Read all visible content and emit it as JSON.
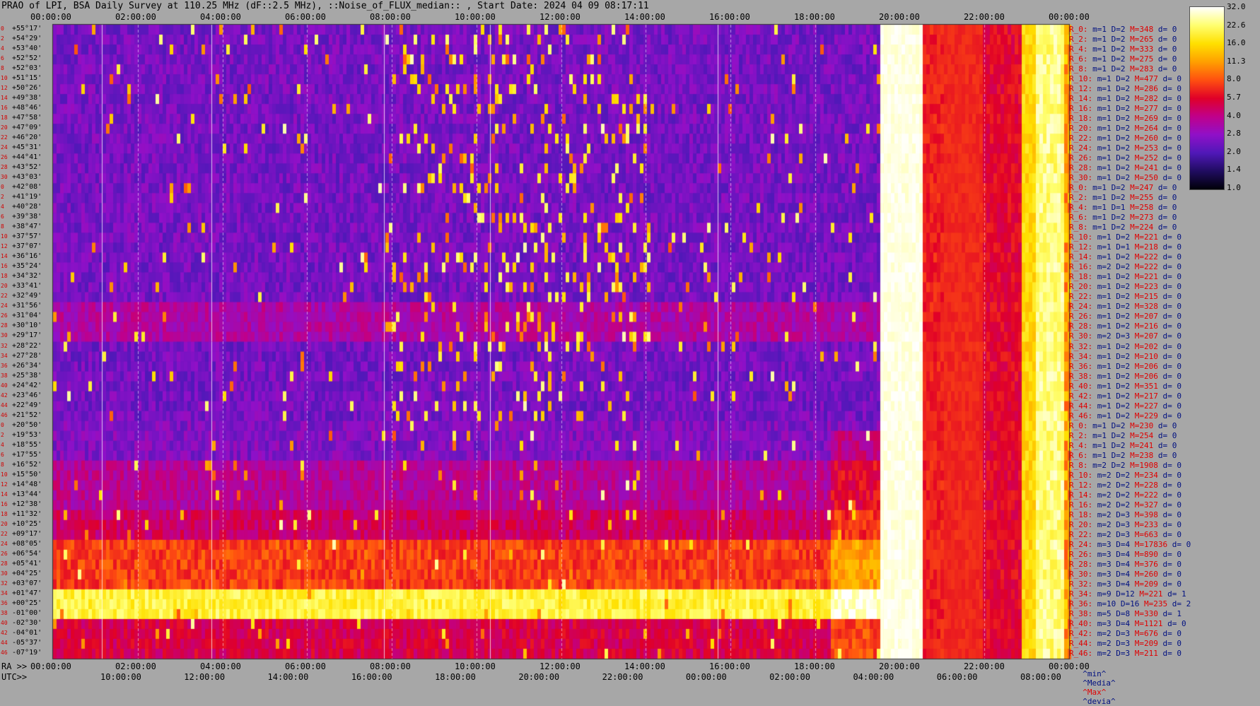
{
  "title": "PRAO of LPI, BSA Daily Survey at 110.25 MHz (dF::2.5 MHz), ::Noise_of_FLUX_median:: , Start Date: 2024 04 09 08:17:11",
  "chart_data": {
    "type": "heatmap",
    "title": "PRAO of LPI, BSA Daily Survey at 110.25 MHz (dF::2.5 MHz), ::Noise_of_FLUX_median:: , Start Date: 2024 04 09 08:17:11",
    "x_top_ticks": [
      "00:00:00",
      "02:00:00",
      "04:00:00",
      "06:00:00",
      "08:00:00",
      "10:00:00",
      "12:00:00",
      "14:00:00",
      "16:00:00",
      "18:00:00",
      "20:00:00",
      "22:00:00",
      "00:00:00"
    ],
    "x_ra_ticks": [
      "00:00:00",
      "02:00:00",
      "04:00:00",
      "06:00:00",
      "08:00:00",
      "10:00:00",
      "12:00:00",
      "14:00:00",
      "16:00:00",
      "18:00:00",
      "20:00:00",
      "22:00:00",
      "00:00:00"
    ],
    "x_utc_ticks": [
      "10:00:00",
      "12:00:00",
      "14:00:00",
      "16:00:00",
      "18:00:00",
      "20:00:00",
      "22:00:00",
      "00:00:00",
      "02:00:00",
      "04:00:00",
      "06:00:00",
      "08:00:00"
    ],
    "xlabel_ra": "RA >>",
    "xlabel_utc": "UTC>>",
    "declinations": [
      "+55°17'",
      "+54°29'",
      "+53°40'",
      "+52°52'",
      "+52°03'",
      "+51°15'",
      "+50°26'",
      "+49°38'",
      "+48°46'",
      "+47°58'",
      "+47°09'",
      "+46°20'",
      "+45°31'",
      "+44°41'",
      "+43°52'",
      "+43°03'",
      "+42°08'",
      "+41°19'",
      "+40°28'",
      "+39°38'",
      "+38°47'",
      "+37°57'",
      "+37°07'",
      "+36°16'",
      "+35°24'",
      "+34°32'",
      "+33°41'",
      "+32°49'",
      "+31°56'",
      "+31°04'",
      "+30°10'",
      "+29°17'",
      "+28°22'",
      "+27°28'",
      "+26°34'",
      "+25°38'",
      "+24°42'",
      "+23°46'",
      "+22°49'",
      "+21°52'",
      "+20°50'",
      "+19°53'",
      "+18°55'",
      "+17°55'",
      "+16°52'",
      "+15°50'",
      "+14°48'",
      "+13°44'",
      "+12°38'",
      "+11°32'",
      "+10°25'",
      "+09°17'",
      "+08°05'",
      "+06°54'",
      "+05°41'",
      "+04°25'",
      "+03°07'",
      "+01°47'",
      "+00°25'",
      "-01°00'",
      "-02°30'",
      "-04°01'",
      "-05°37'",
      "-07°19'"
    ],
    "row_indices": [
      "0",
      "2",
      "4",
      "6",
      "8",
      "10",
      "12",
      "14",
      "16",
      "18",
      "20",
      "22",
      "24",
      "26",
      "28",
      "30",
      "0",
      "2",
      "4",
      "6",
      "8",
      "10",
      "12",
      "14",
      "16",
      "18",
      "20",
      "22",
      "24",
      "26",
      "28",
      "30",
      "32",
      "34",
      "36",
      "38",
      "40",
      "42",
      "44",
      "46",
      "0",
      "2",
      "4",
      "6",
      "8",
      "10",
      "12",
      "14",
      "16",
      "18",
      "20",
      "22",
      "24",
      "26",
      "28",
      "30",
      "32",
      "34",
      "36",
      "38",
      "40",
      "42",
      "44",
      "46"
    ],
    "colorbar": {
      "ticks": [
        "32.0",
        "22.6",
        "16.0",
        "11.3",
        "8.0",
        "5.7",
        "4.0",
        "2.8",
        "2.0",
        "1.4",
        "1.0"
      ],
      "colors": [
        "#ffffff",
        "#ffff70",
        "#ffe000",
        "#ffa000",
        "#ff5010",
        "#e00028",
        "#c0008a",
        "#9010c8",
        "#5018b8",
        "#200c60",
        "#000008"
      ]
    },
    "stats": [
      {
        "r": "R_0:",
        "m": "1",
        "D": "2",
        "M": "348",
        "d": "0"
      },
      {
        "r": "R_2:",
        "m": "1",
        "D": "2",
        "M": "265",
        "d": "0"
      },
      {
        "r": "R_4:",
        "m": "1",
        "D": "2",
        "M": "333",
        "d": "0"
      },
      {
        "r": "R_6:",
        "m": "1",
        "D": "2",
        "M": "275",
        "d": "0"
      },
      {
        "r": "R_8:",
        "m": "1",
        "D": "2",
        "M": "283",
        "d": "0"
      },
      {
        "r": "R_10:",
        "m": "1",
        "D": "2",
        "M": "477",
        "d": "0"
      },
      {
        "r": "R_12:",
        "m": "1",
        "D": "2",
        "M": "286",
        "d": "0"
      },
      {
        "r": "R_14:",
        "m": "1",
        "D": "2",
        "M": "282",
        "d": "0"
      },
      {
        "r": "R_16:",
        "m": "1",
        "D": "2",
        "M": "277",
        "d": "0"
      },
      {
        "r": "R_18:",
        "m": "1",
        "D": "2",
        "M": "269",
        "d": "0"
      },
      {
        "r": "R_20:",
        "m": "1",
        "D": "2",
        "M": "264",
        "d": "0"
      },
      {
        "r": "R_22:",
        "m": "1",
        "D": "2",
        "M": "260",
        "d": "0"
      },
      {
        "r": "R_24:",
        "m": "1",
        "D": "2",
        "M": "253",
        "d": "0"
      },
      {
        "r": "R_26:",
        "m": "1",
        "D": "2",
        "M": "252",
        "d": "0"
      },
      {
        "r": "R_28:",
        "m": "1",
        "D": "2",
        "M": "241",
        "d": "0"
      },
      {
        "r": "R_30:",
        "m": "1",
        "D": "2",
        "M": "250",
        "d": "0"
      },
      {
        "r": "R_0:",
        "m": "1",
        "D": "2",
        "M": "247",
        "d": "0"
      },
      {
        "r": "R_2:",
        "m": "1",
        "D": "2",
        "M": "255",
        "d": "0"
      },
      {
        "r": "R_4:",
        "m": "1",
        "D": "1",
        "M": "258",
        "d": "0"
      },
      {
        "r": "R_6:",
        "m": "1",
        "D": "2",
        "M": "273",
        "d": "0"
      },
      {
        "r": "R_8:",
        "m": "1",
        "D": "2",
        "M": "224",
        "d": "0"
      },
      {
        "r": "R_10:",
        "m": "1",
        "D": "2",
        "M": "221",
        "d": "0"
      },
      {
        "r": "R_12:",
        "m": "1",
        "D": "1",
        "M": "218",
        "d": "0"
      },
      {
        "r": "R_14:",
        "m": "1",
        "D": "2",
        "M": "222",
        "d": "0"
      },
      {
        "r": "R_16:",
        "m": "2",
        "D": "2",
        "M": "222",
        "d": "0"
      },
      {
        "r": "R_18:",
        "m": "1",
        "D": "2",
        "M": "221",
        "d": "0"
      },
      {
        "r": "R_20:",
        "m": "1",
        "D": "2",
        "M": "223",
        "d": "0"
      },
      {
        "r": "R_22:",
        "m": "1",
        "D": "2",
        "M": "215",
        "d": "0"
      },
      {
        "r": "R_24:",
        "m": "1",
        "D": "2",
        "M": "328",
        "d": "0"
      },
      {
        "r": "R_26:",
        "m": "1",
        "D": "2",
        "M": "207",
        "d": "0"
      },
      {
        "r": "R_28:",
        "m": "1",
        "D": "2",
        "M": "216",
        "d": "0"
      },
      {
        "r": "R_30:",
        "m": "2",
        "D": "3",
        "M": "207",
        "d": "0"
      },
      {
        "r": "R_32:",
        "m": "1",
        "D": "2",
        "M": "202",
        "d": "0"
      },
      {
        "r": "R_34:",
        "m": "1",
        "D": "2",
        "M": "210",
        "d": "0"
      },
      {
        "r": "R_36:",
        "m": "1",
        "D": "2",
        "M": "206",
        "d": "0"
      },
      {
        "r": "R_38:",
        "m": "1",
        "D": "2",
        "M": "206",
        "d": "0"
      },
      {
        "r": "R_40:",
        "m": "1",
        "D": "2",
        "M": "351",
        "d": "0"
      },
      {
        "r": "R_42:",
        "m": "1",
        "D": "2",
        "M": "217",
        "d": "0"
      },
      {
        "r": "R_44:",
        "m": "1",
        "D": "2",
        "M": "227",
        "d": "0"
      },
      {
        "r": "R_46:",
        "m": "1",
        "D": "2",
        "M": "229",
        "d": "0"
      },
      {
        "r": "R_0:",
        "m": "1",
        "D": "2",
        "M": "230",
        "d": "0"
      },
      {
        "r": "R_2:",
        "m": "1",
        "D": "2",
        "M": "254",
        "d": "0"
      },
      {
        "r": "R_4:",
        "m": "1",
        "D": "2",
        "M": "241",
        "d": "0"
      },
      {
        "r": "R_6:",
        "m": "1",
        "D": "2",
        "M": "238",
        "d": "0"
      },
      {
        "r": "R_8:",
        "m": "2",
        "D": "2",
        "M": "1908",
        "d": "0"
      },
      {
        "r": "R_10:",
        "m": "2",
        "D": "2",
        "M": "234",
        "d": "0"
      },
      {
        "r": "R_12:",
        "m": "2",
        "D": "2",
        "M": "228",
        "d": "0"
      },
      {
        "r": "R_14:",
        "m": "2",
        "D": "2",
        "M": "222",
        "d": "0"
      },
      {
        "r": "R_16:",
        "m": "2",
        "D": "2",
        "M": "327",
        "d": "0"
      },
      {
        "r": "R_18:",
        "m": "2",
        "D": "3",
        "M": "398",
        "d": "0"
      },
      {
        "r": "R_20:",
        "m": "2",
        "D": "3",
        "M": "233",
        "d": "0"
      },
      {
        "r": "R_22:",
        "m": "2",
        "D": "3",
        "M": "663",
        "d": "0"
      },
      {
        "r": "R_24:",
        "m": "3",
        "D": "4",
        "M": "17836",
        "d": "0"
      },
      {
        "r": "R_26:",
        "m": "3",
        "D": "4",
        "M": "890",
        "d": "0"
      },
      {
        "r": "R_28:",
        "m": "3",
        "D": "4",
        "M": "376",
        "d": "0"
      },
      {
        "r": "R_30:",
        "m": "3",
        "D": "4",
        "M": "260",
        "d": "0"
      },
      {
        "r": "R_32:",
        "m": "3",
        "D": "4",
        "M": "209",
        "d": "0"
      },
      {
        "r": "R_34:",
        "m": "9",
        "D": "12",
        "M": "221",
        "d": "1"
      },
      {
        "r": "R_36:",
        "m": "10",
        "D": "16",
        "M": "235",
        "d": "2"
      },
      {
        "r": "R_38:",
        "m": "5",
        "D": "8",
        "M": "330",
        "d": "1"
      },
      {
        "r": "R_40:",
        "m": "3",
        "D": "4",
        "M": "1121",
        "d": "0"
      },
      {
        "r": "R_42:",
        "m": "2",
        "D": "3",
        "M": "676",
        "d": "0"
      },
      {
        "r": "R_44:",
        "m": "2",
        "D": "3",
        "M": "209",
        "d": "0"
      },
      {
        "r": "R_46:",
        "m": "2",
        "D": "3",
        "M": "211",
        "d": "0"
      }
    ],
    "legend": [
      "^min^",
      "^Media^",
      "^Max^",
      "^devia^"
    ]
  }
}
